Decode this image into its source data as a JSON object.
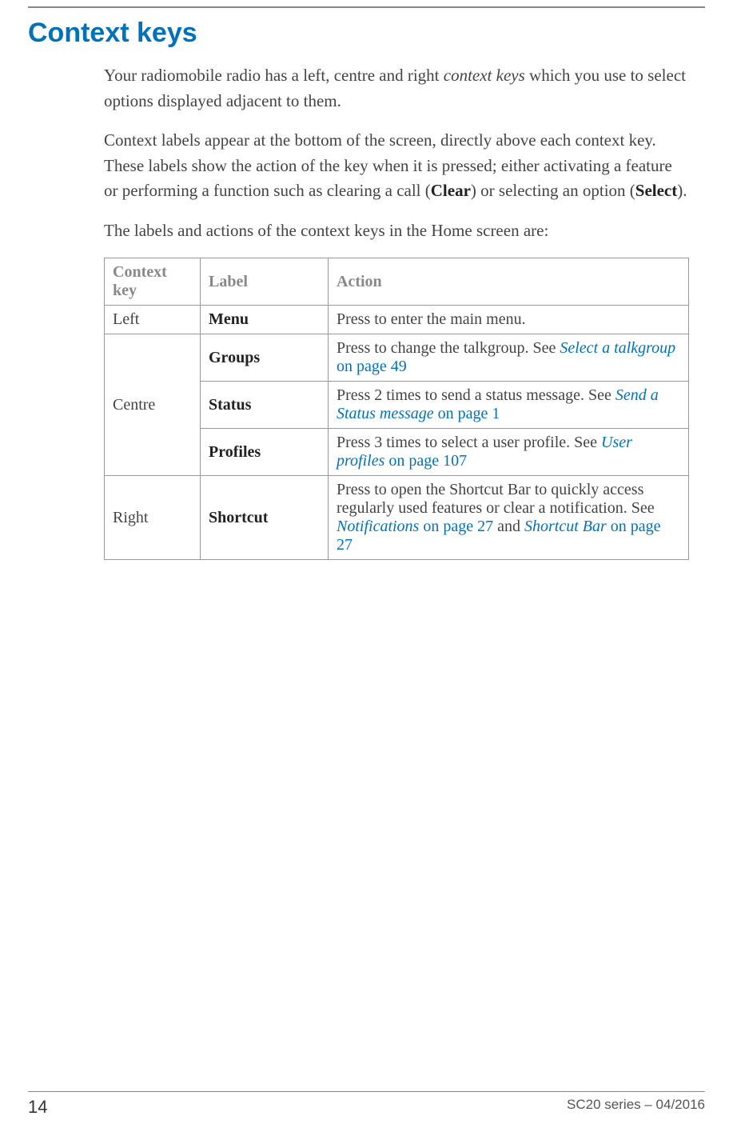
{
  "heading": "Context keys",
  "para1_a": "Your radiomobile radio has a left, centre and right ",
  "para1_em": "context keys",
  "para1_b": " which you use to select options displayed adjacent to them.",
  "para2_a": "Context labels appear at the bottom of the screen, directly above each context key. These labels show the action of the key when it is pressed; either activating a feature or performing a function such as clearing a call (",
  "para2_b1": "Clear",
  "para2_c": ") or selecting an option (",
  "para2_b2": "Select",
  "para2_d": ").",
  "para3": "The labels and actions of the context keys in the Home screen are:",
  "th1": "Context key",
  "th2": "Label",
  "th3": "Action",
  "r1_key": "Left",
  "r1_label": "Menu",
  "r1_action": "Press to enter the main menu.",
  "centre_key": "Centre",
  "r2_label": "Groups",
  "r2_action_a": "Press to change the talkgroup. See ",
  "r2_link": "Select a talkgroup",
  "r2_tail": " on page 49",
  "r3_label": "Status",
  "r3_action_a": "Press 2 times to send a status message. See ",
  "r3_link": "Send a Status message",
  "r3_tail": " on page 1",
  "r4_label": "Profiles",
  "r4_action_a": "Press 3 times to select a user profile. See ",
  "r4_link": "User profiles",
  "r4_tail": "  on page 107",
  "r5_key": "Right",
  "r5_label": "Shortcut",
  "r5_action_a": "Press to open the Shortcut Bar to quickly access regularly used features or clear a notification. See ",
  "r5_link1": "Notifications",
  "r5_mid": "  on page 27",
  "r5_and": " and ",
  "r5_link2": "Shortcut Bar",
  "r5_tail": " on page 27",
  "footer_page": "14",
  "footer_doc": "SC20 series – 04/2016"
}
